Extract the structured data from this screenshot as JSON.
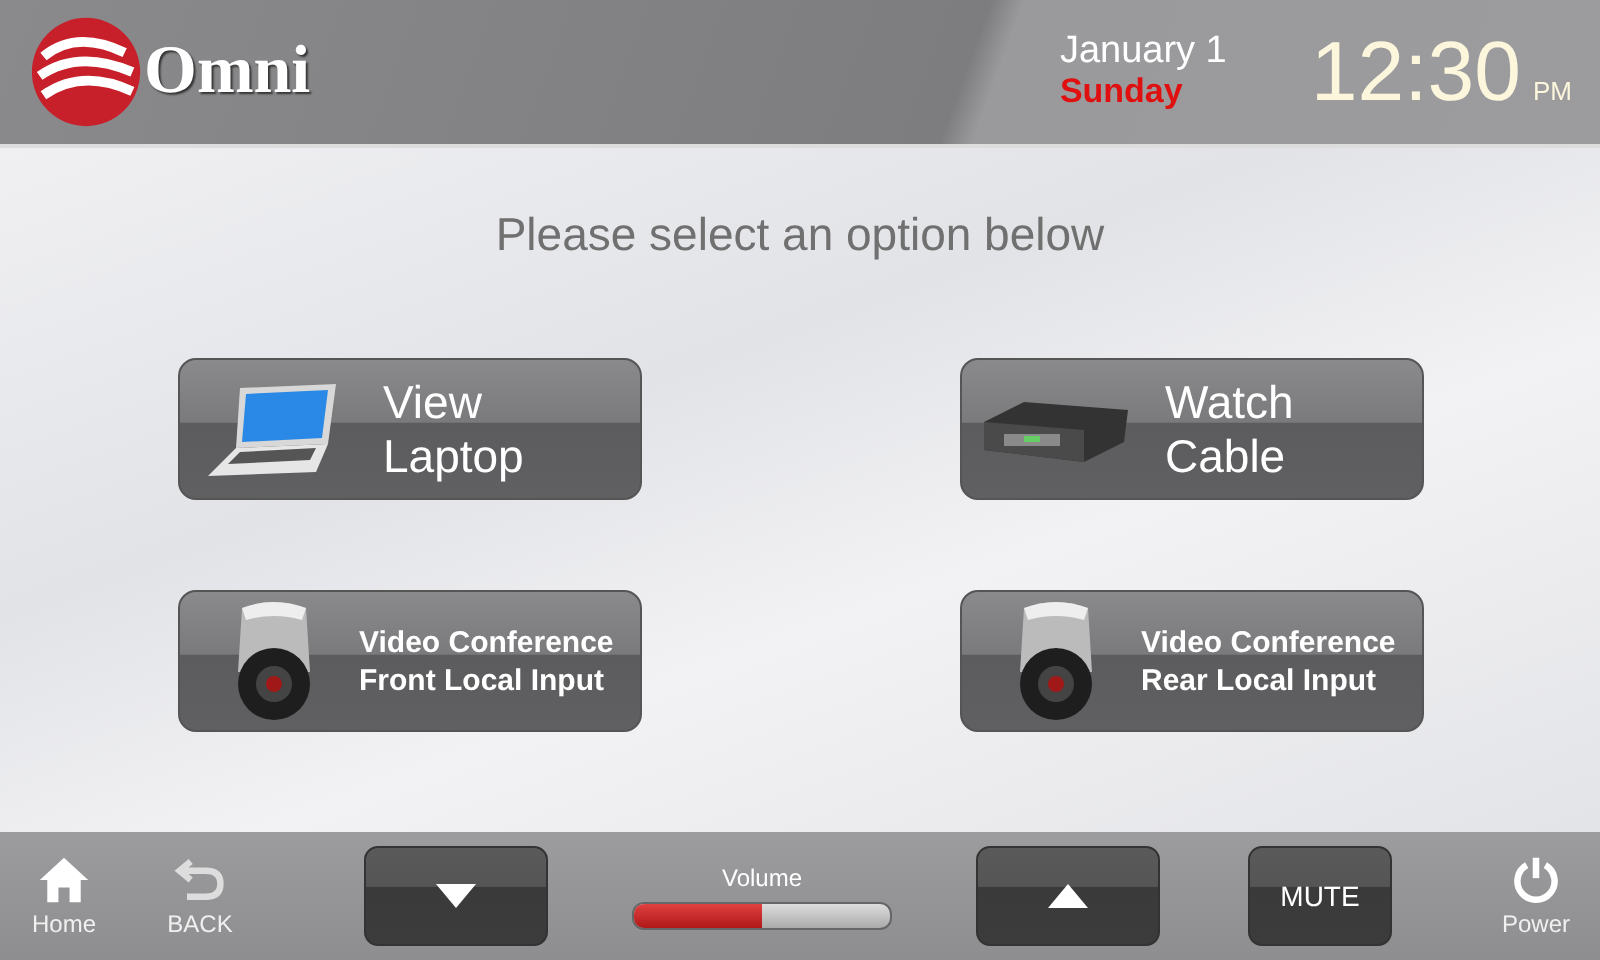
{
  "header": {
    "logo_text": "Omni",
    "date": "January 1",
    "weekday": "Sunday",
    "time": "12:30",
    "meridiem": "PM"
  },
  "prompt": "Please select an option below",
  "options": [
    {
      "kind": "laptop",
      "lines": [
        "View",
        "Laptop"
      ]
    },
    {
      "kind": "cable",
      "lines": [
        "Watch",
        "Cable"
      ]
    },
    {
      "kind": "camera",
      "lines": [
        "Video Conference",
        "Front Local Input"
      ]
    },
    {
      "kind": "camera",
      "lines": [
        "Video Conference",
        "Rear Local Input"
      ]
    }
  ],
  "footer": {
    "home": "Home",
    "back": "BACK",
    "volume_label": "Volume",
    "volume": {
      "level": 0.5
    },
    "mute": "MUTE",
    "power": "Power"
  }
}
